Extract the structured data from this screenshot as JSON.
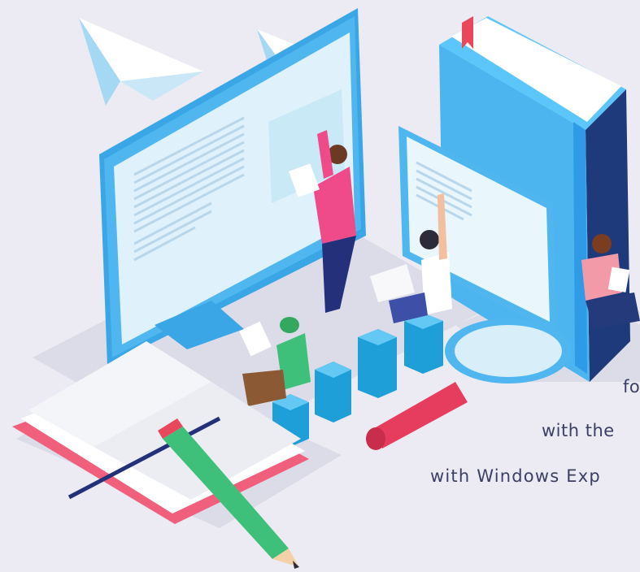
{
  "caption": {
    "lines": [
      "fo",
      "with the",
      "with Windows Exp"
    ]
  },
  "colors": {
    "background": "#ecebf3",
    "monitor_frame": "#4fb6ef",
    "screen": "#dff2fb",
    "book_blue": "#2f9be6",
    "notebook_pink": "#f0607d",
    "pencil_green": "#3fc07a",
    "magnifier_red": "#e63d5f",
    "text": "#3a3f63"
  }
}
